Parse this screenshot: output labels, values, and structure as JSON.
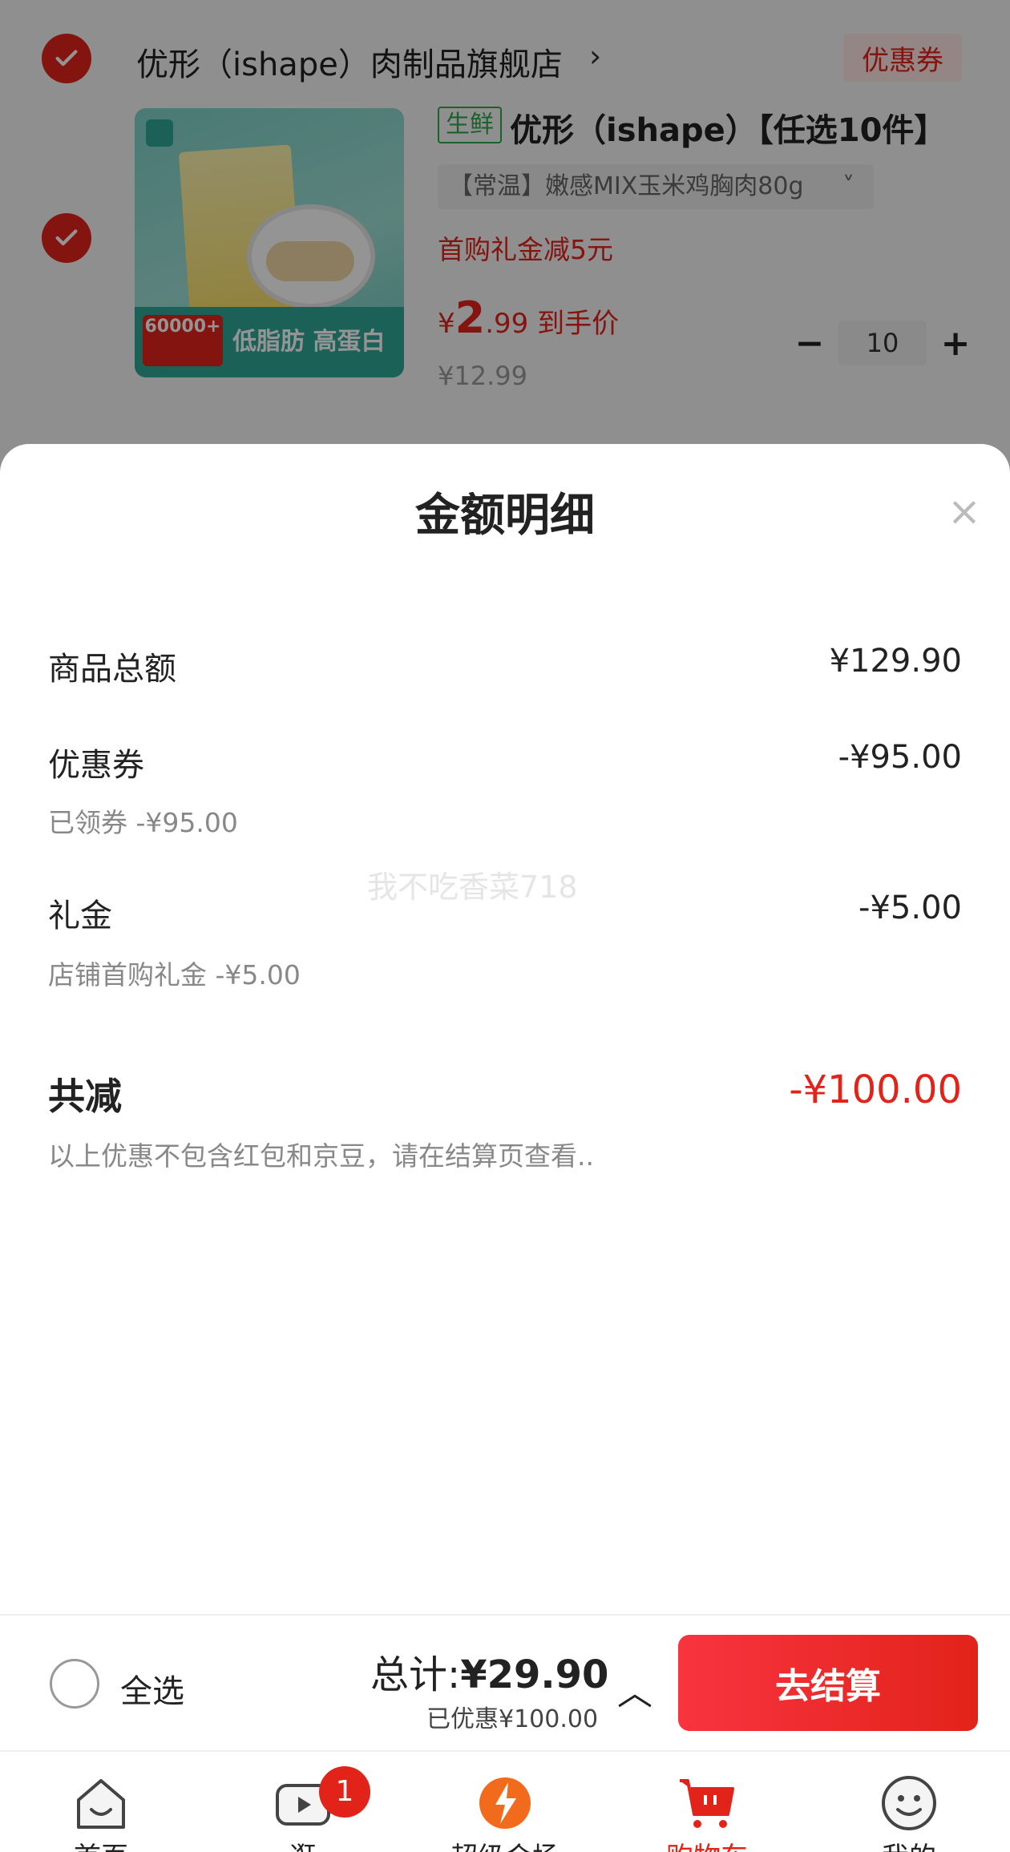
{
  "store": {
    "name": "优形（ishape）肉制品旗舰店",
    "arrow": "›",
    "coupon_label": "优惠券"
  },
  "product": {
    "tag": "生鲜",
    "title": "优形（ishape）【任选10件】",
    "variant": "【常温】嫩感MIX玉米鸡胸肉80g",
    "variant_chevron": "˅",
    "first_buy": "首购礼金减5元",
    "price_currency": "¥",
    "price_int": "2",
    "price_dec": ".99",
    "price_suffix": " 到手价",
    "price_original": "¥12.99",
    "quantity": "10",
    "minus": "−",
    "plus": "+",
    "image_badge": "60000+",
    "image_band_text": "低脂肪 高蛋白"
  },
  "sheet": {
    "title": "金额明细",
    "close": "×",
    "rows": [
      {
        "label": "商品总额",
        "value": "¥129.90",
        "sub": ""
      },
      {
        "label": "优惠券",
        "value": "-¥95.00",
        "sub": "已领券 -¥95.00"
      },
      {
        "label": "礼金",
        "value": "-¥5.00",
        "sub": "店铺首购礼金 -¥5.00"
      }
    ],
    "total_label": "共减",
    "total_value": "-¥100.00",
    "note": "以上优惠不包含红包和京豆，请在结算页查看..",
    "watermark": "我不吃香菜718"
  },
  "checkout": {
    "select_all": "全选",
    "total_prefix": "总计:",
    "total_amount": "¥29.90",
    "saved": "已优惠¥100.00",
    "caret": "︿",
    "button": "去结算"
  },
  "tabs": [
    {
      "label": "首页",
      "icon": "home-icon"
    },
    {
      "label": "逛",
      "icon": "video-icon",
      "badge": "1"
    },
    {
      "label": "超级会场",
      "icon": "super-venue-icon"
    },
    {
      "label": "购物车",
      "icon": "cart-icon"
    },
    {
      "label": "我的",
      "icon": "profile-icon"
    }
  ],
  "colors": {
    "accent": "#e2231a",
    "fresh_green": "#2ea84a"
  }
}
